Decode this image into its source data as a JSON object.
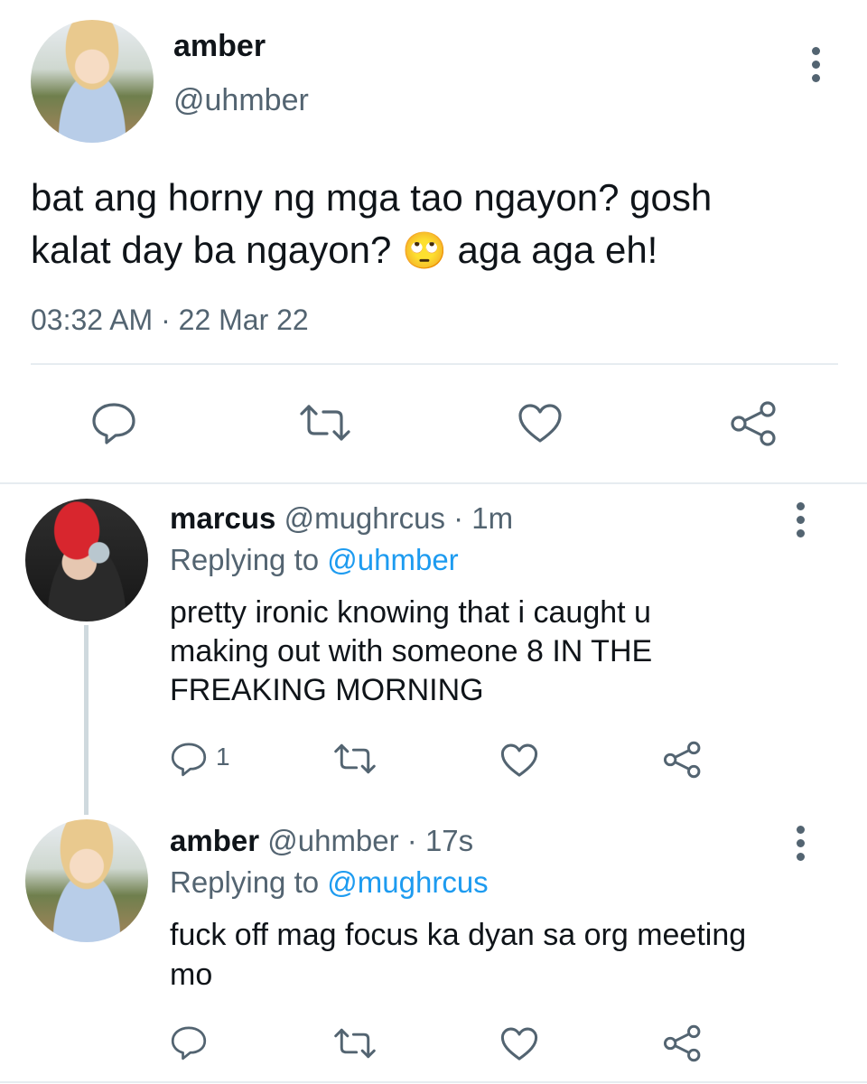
{
  "main_tweet": {
    "display_name": "amber",
    "handle": "@uhmber",
    "text_line1": "bat ang horny ng mga tao ngayon? gosh",
    "text_line2_before": "kalat day ba ngayon?",
    "emoji": "🙄",
    "text_line2_after": "aga aga eh!",
    "timestamp": "03:32 AM · 22 Mar 22",
    "actions": [
      "reply-icon",
      "retweet-icon",
      "like-icon",
      "share-icon"
    ]
  },
  "replies": [
    {
      "display_name": "marcus",
      "handle": "@mughrcus",
      "time": "· 1m",
      "replying_prefix": "Replying to",
      "replying_handle": "@uhmber",
      "text_lines": [
        "pretty ironic knowing that i caught u",
        "making out with someone 8 IN THE",
        "FREAKING MORNING"
      ],
      "reply_count": "1"
    },
    {
      "display_name": "amber",
      "handle": "@uhmber",
      "time": "· 17s",
      "replying_prefix": "Replying to",
      "replying_handle": "@mughrcus",
      "text_lines": [
        "fuck off mag focus ka dyan sa org meeting",
        "mo"
      ]
    }
  ],
  "colors": {
    "text": "#0f1419",
    "muted": "#536471",
    "link": "#1d9bf0",
    "divider": "#e6ecf0"
  }
}
